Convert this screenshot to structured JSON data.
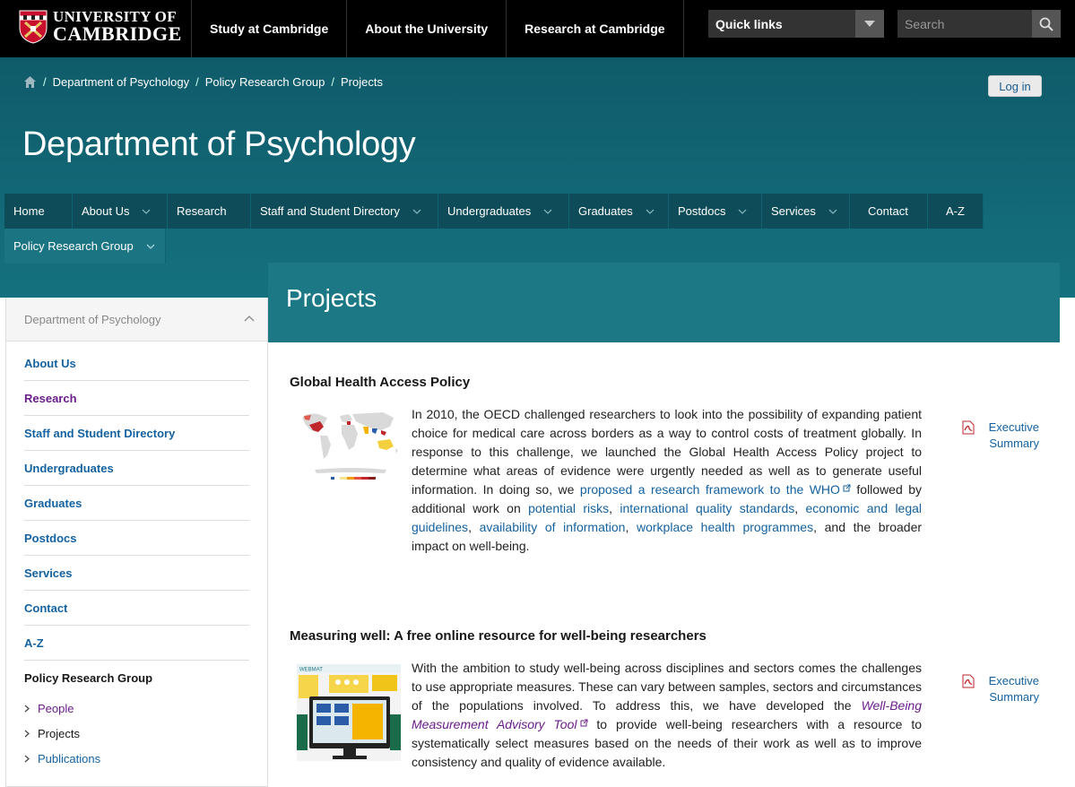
{
  "header": {
    "logo": {
      "line1": "UNIVERSITY OF",
      "line2": "CAMBRIDGE"
    },
    "nav": [
      "Study at Cambridge",
      "About the University",
      "Research at Cambridge"
    ],
    "quick_links": "Quick links",
    "search_placeholder": "Search"
  },
  "breadcrumb": [
    "Department of Psychology",
    "Policy Research Group",
    "Projects"
  ],
  "login_label": "Log in",
  "dept_title": "Department of Psychology",
  "main_nav": {
    "row1": [
      {
        "label": "Home",
        "dropdown": false
      },
      {
        "label": "About Us",
        "dropdown": true
      },
      {
        "label": "Research",
        "dropdown": false
      },
      {
        "label": "Staff and Student Directory",
        "dropdown": true
      },
      {
        "label": "Undergraduates",
        "dropdown": true
      },
      {
        "label": "Graduates",
        "dropdown": true
      },
      {
        "label": "Postdocs",
        "dropdown": true
      },
      {
        "label": "Services",
        "dropdown": true
      },
      {
        "label": "Contact",
        "dropdown": false
      },
      {
        "label": "A-Z",
        "dropdown": false
      }
    ],
    "row2": [
      {
        "label": "Policy Research Group",
        "dropdown": true
      }
    ]
  },
  "page_title": "Projects",
  "sidebar": {
    "heading": "Department of Psychology",
    "items": [
      "About Us",
      "Research",
      "Staff and Student Directory",
      "Undergraduates",
      "Graduates",
      "Postdocs",
      "Services",
      "Contact",
      "A-Z"
    ],
    "current": "Policy Research Group",
    "subitems": [
      "People",
      "Projects",
      "Publications"
    ]
  },
  "projects": [
    {
      "title": "Global Health Access Policy",
      "text": {
        "p1": "In 2010, the OECD challenged researchers to look into the possibility of expanding patient choice for medical care across borders as a way to control costs of treatment globally. In response to this challenge, we launched the Global Health Access Policy project to determine what areas of evidence were urgently needed as well as to generate useful information. In doing so, we ",
        "link1": "proposed a research framework to the WHO",
        "p2": " followed by additional work on ",
        "link2": "potential risks",
        "c1": ", ",
        "link3": "international quality standards",
        "c2": ", ",
        "link4": "economic and legal guidelines",
        "c3": ", ",
        "link5": "availability of information",
        "c4": ", ",
        "link6": "workplace health programmes",
        "p3": ", and the broader impact on well-being."
      },
      "exec_summary": "Executive Summary"
    },
    {
      "title": "Measuring well: A free online resource for well-being researchers",
      "text": {
        "p1": "With the ambition to study well-being across disciplines and sectors comes the challenges to use appropriate measures. These can vary between samples, sectors and circumstances of the populations involved. To address this, we have developed the ",
        "link1": "Well-Being Measurement Advisory Tool",
        "p2": " to provide well-being researchers with a resource to systematically select measures based on the needs of their work as well as to improve consistency and quality of evidence available."
      },
      "thumb_label": "WEBMAT",
      "exec_summary": "Executive Summary"
    }
  ],
  "colors": {
    "header_bg": "#000000",
    "banner": "#15717f",
    "nav_bg": "#0d4c58",
    "title_bar": "#1d7886",
    "link": "#1462a0",
    "visited": "#6b1d8a"
  }
}
